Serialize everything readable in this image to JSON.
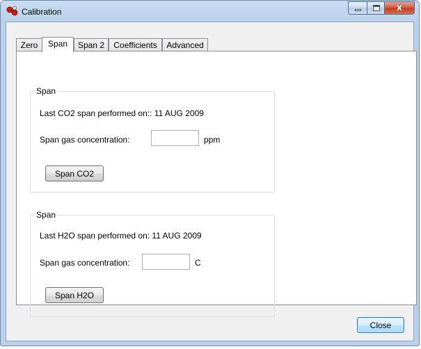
{
  "window": {
    "title": "Calibration",
    "minimize_glyph": "",
    "maximize_glyph": "",
    "close_glyph": "x",
    "icon": "calibration-app-icon"
  },
  "tabs": [
    {
      "label": "Zero"
    },
    {
      "label": "Span",
      "selected": true
    },
    {
      "label": "Span 2"
    },
    {
      "label": "Coefficients"
    },
    {
      "label": "Advanced"
    }
  ],
  "co2_group": {
    "legend": "Span",
    "last_span_text": "Last CO2 span performed on:: 11 AUG 2009",
    "concentration_label": "Span gas concentration:",
    "concentration_value": "",
    "unit": "ppm",
    "button_label": "Span CO2"
  },
  "h2o_group": {
    "legend": "Span",
    "last_span_text": "Last H2O span performed on: 11 AUG 2009",
    "concentration_label": "Span gas concentration:",
    "concentration_value": "",
    "unit": "C",
    "button_label": "Span H2O"
  },
  "footer": {
    "close_label": "Close"
  }
}
